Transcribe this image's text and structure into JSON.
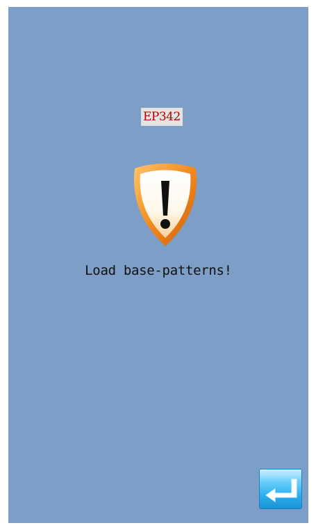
{
  "dialog": {
    "error_code": "EP342",
    "message": "Load base-patterns!",
    "icon": "warning-shield-icon"
  },
  "controls": {
    "return_button_icon": "return-arrow-icon"
  },
  "colors": {
    "background": "#7d9ec6",
    "error_code_text": "#b40000",
    "error_code_background": "#e3e3e3",
    "shield_orange": "#f08a1c",
    "button_blue": "#2cb0ef"
  }
}
